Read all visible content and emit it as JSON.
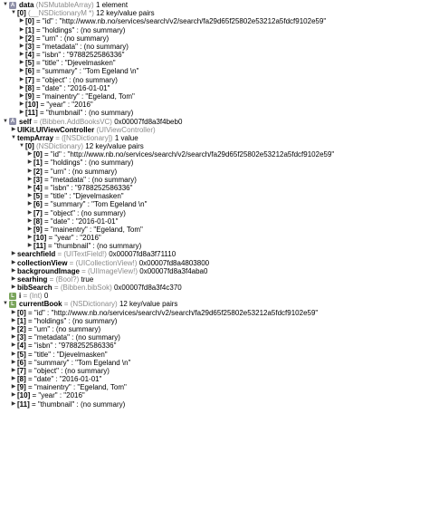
{
  "rows": [
    {
      "indent": 0,
      "tri": "down",
      "badge": "A",
      "name": "data",
      "type": "(NSMutableArray)",
      "value": "1 element"
    },
    {
      "indent": 1,
      "tri": "down",
      "badge": "",
      "name": "[0]",
      "type": "(__NSDictionaryM *)",
      "value": "12 key/value pairs"
    },
    {
      "indent": 2,
      "tri": "right",
      "badge": "",
      "name": "[0]",
      "type": "",
      "value": "= \"id\" : \"http://www.nb.no/services/search/v2/search/fa29d65f25802e53212a5fdcf9102e59\""
    },
    {
      "indent": 2,
      "tri": "right",
      "badge": "",
      "name": "[1]",
      "type": "",
      "value": "= \"holdings\" : (no summary)"
    },
    {
      "indent": 2,
      "tri": "right",
      "badge": "",
      "name": "[2]",
      "type": "",
      "value": "= \"urn\" : (no summary)"
    },
    {
      "indent": 2,
      "tri": "right",
      "badge": "",
      "name": "[3]",
      "type": "",
      "value": "= \"metadata\" : (no summary)"
    },
    {
      "indent": 2,
      "tri": "right",
      "badge": "",
      "name": "[4]",
      "type": "",
      "value": "= \"isbn\" : \"9788252586336\""
    },
    {
      "indent": 2,
      "tri": "right",
      "badge": "",
      "name": "[5]",
      "type": "",
      "value": "= \"title\" : \"Djevelmasken\""
    },
    {
      "indent": 2,
      "tri": "right",
      "badge": "",
      "name": "[6]",
      "type": "",
      "value": "= \"summary\" : \"Tom Egeland \\n\""
    },
    {
      "indent": 2,
      "tri": "right",
      "badge": "",
      "name": "[7]",
      "type": "",
      "value": "= \"object\" : (no summary)"
    },
    {
      "indent": 2,
      "tri": "right",
      "badge": "",
      "name": "[8]",
      "type": "",
      "value": "= \"date\" : \"2016-01-01\""
    },
    {
      "indent": 2,
      "tri": "right",
      "badge": "",
      "name": "[9]",
      "type": "",
      "value": "= \"mainentry\" : \"Egeland, Tom\""
    },
    {
      "indent": 2,
      "tri": "right",
      "badge": "",
      "name": "[10]",
      "type": "",
      "value": "= \"year\" : \"2016\""
    },
    {
      "indent": 2,
      "tri": "right",
      "badge": "",
      "name": "[11]",
      "type": "",
      "value": "= \"thumbnail\" : (no summary)"
    },
    {
      "indent": 0,
      "tri": "down",
      "badge": "A",
      "name": "self",
      "type": "= (Bibben.AddBooksVC)",
      "value": "0x00007fd8a3f4beb0"
    },
    {
      "indent": 1,
      "tri": "right",
      "badge": "",
      "name": "UIKit.UIViewController",
      "type": "(UIViewController)",
      "value": ""
    },
    {
      "indent": 1,
      "tri": "down",
      "badge": "",
      "name": "tempArray",
      "type": "= ([NSDictionary])",
      "value": "1 value"
    },
    {
      "indent": 2,
      "tri": "down",
      "badge": "",
      "name": "[0]",
      "type": "(NSDictionary)",
      "value": "12 key/value pairs"
    },
    {
      "indent": 3,
      "tri": "right",
      "badge": "",
      "name": "[0]",
      "type": "",
      "value": "= \"id\" : \"http://www.nb.no/services/search/v2/search/fa29d65f25802e53212a5fdcf9102e59\""
    },
    {
      "indent": 3,
      "tri": "right",
      "badge": "",
      "name": "[1]",
      "type": "",
      "value": "= \"holdings\" : (no summary)"
    },
    {
      "indent": 3,
      "tri": "right",
      "badge": "",
      "name": "[2]",
      "type": "",
      "value": "= \"urn\" : (no summary)"
    },
    {
      "indent": 3,
      "tri": "right",
      "badge": "",
      "name": "[3]",
      "type": "",
      "value": "= \"metadata\" : (no summary)"
    },
    {
      "indent": 3,
      "tri": "right",
      "badge": "",
      "name": "[4]",
      "type": "",
      "value": "= \"isbn\" : \"9788252586336\""
    },
    {
      "indent": 3,
      "tri": "right",
      "badge": "",
      "name": "[5]",
      "type": "",
      "value": "= \"title\" : \"Djevelmasken\""
    },
    {
      "indent": 3,
      "tri": "right",
      "badge": "",
      "name": "[6]",
      "type": "",
      "value": "= \"summary\" : \"Tom Egeland \\n\""
    },
    {
      "indent": 3,
      "tri": "right",
      "badge": "",
      "name": "[7]",
      "type": "",
      "value": "= \"object\" : (no summary)"
    },
    {
      "indent": 3,
      "tri": "right",
      "badge": "",
      "name": "[8]",
      "type": "",
      "value": "= \"date\" : \"2016-01-01\""
    },
    {
      "indent": 3,
      "tri": "right",
      "badge": "",
      "name": "[9]",
      "type": "",
      "value": "= \"mainentry\" : \"Egeland, Tom\""
    },
    {
      "indent": 3,
      "tri": "right",
      "badge": "",
      "name": "[10]",
      "type": "",
      "value": "= \"year\" : \"2016\""
    },
    {
      "indent": 3,
      "tri": "right",
      "badge": "",
      "name": "[11]",
      "type": "",
      "value": "= \"thumbnail\" : (no summary)"
    },
    {
      "indent": 1,
      "tri": "right",
      "badge": "",
      "name": "searchfield",
      "type": "= (UITextField!)",
      "value": "0x00007fd8a3f71110"
    },
    {
      "indent": 1,
      "tri": "right",
      "badge": "",
      "name": "collectionView",
      "type": "= (UICollectionView!)",
      "value": "0x00007fd8a4803800"
    },
    {
      "indent": 1,
      "tri": "right",
      "badge": "",
      "name": "backgroundImage",
      "type": "= (UIImageView!)",
      "value": "0x00007fd8a3f4aba0"
    },
    {
      "indent": 1,
      "tri": "right",
      "badge": "",
      "name": "searhing",
      "type": "= (Bool?)",
      "value": "true"
    },
    {
      "indent": 1,
      "tri": "right",
      "badge": "",
      "name": "bibSearch",
      "type": "= (Bibben.bibSok)",
      "value": "0x00007fd8a3f4c370"
    },
    {
      "indent": 0,
      "tri": "",
      "badge": "L",
      "name": "i",
      "type": "= (Int)",
      "value": "0"
    },
    {
      "indent": 0,
      "tri": "down",
      "badge": "L",
      "name": "currentBook",
      "type": "= (NSDictionary)",
      "value": "12 key/value pairs"
    },
    {
      "indent": 1,
      "tri": "right",
      "badge": "",
      "name": "[0]",
      "type": "",
      "value": "= \"id\" : \"http://www.nb.no/services/search/v2/search/fa29d65f25802e53212a5fdcf9102e59\""
    },
    {
      "indent": 1,
      "tri": "right",
      "badge": "",
      "name": "[1]",
      "type": "",
      "value": "= \"holdings\" : (no summary)"
    },
    {
      "indent": 1,
      "tri": "right",
      "badge": "",
      "name": "[2]",
      "type": "",
      "value": "= \"urn\" : (no summary)"
    },
    {
      "indent": 1,
      "tri": "right",
      "badge": "",
      "name": "[3]",
      "type": "",
      "value": "= \"metadata\" : (no summary)"
    },
    {
      "indent": 1,
      "tri": "right",
      "badge": "",
      "name": "[4]",
      "type": "",
      "value": "= \"isbn\" : \"9788252586336\""
    },
    {
      "indent": 1,
      "tri": "right",
      "badge": "",
      "name": "[5]",
      "type": "",
      "value": "= \"title\" : \"Djevelmasken\""
    },
    {
      "indent": 1,
      "tri": "right",
      "badge": "",
      "name": "[6]",
      "type": "",
      "value": "= \"summary\" : \"Tom Egeland \\n\""
    },
    {
      "indent": 1,
      "tri": "right",
      "badge": "",
      "name": "[7]",
      "type": "",
      "value": "= \"object\" : (no summary)"
    },
    {
      "indent": 1,
      "tri": "right",
      "badge": "",
      "name": "[8]",
      "type": "",
      "value": "= \"date\" : \"2016-01-01\""
    },
    {
      "indent": 1,
      "tri": "right",
      "badge": "",
      "name": "[9]",
      "type": "",
      "value": "= \"mainentry\" : \"Egeland, Tom\""
    },
    {
      "indent": 1,
      "tri": "right",
      "badge": "",
      "name": "[10]",
      "type": "",
      "value": "= \"year\" : \"2016\""
    },
    {
      "indent": 1,
      "tri": "right",
      "badge": "",
      "name": "[11]",
      "type": "",
      "value": "= \"thumbnail\" : (no summary)"
    }
  ]
}
